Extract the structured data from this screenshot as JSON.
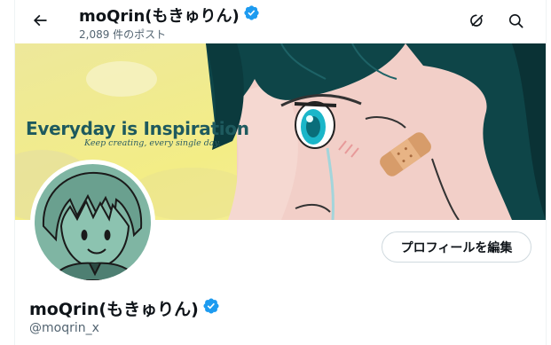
{
  "header": {
    "display_name": "moQrin(もきゅりん)",
    "post_count": "2,089 件のポスト"
  },
  "banner": {
    "headline": "Everyday is Inspiration",
    "tagline": "Keep creating, every single day."
  },
  "profile": {
    "display_name": "moQrin(もきゅりん)",
    "handle": "@moqrin_x",
    "edit_button_label": "プロフィールを編集"
  },
  "icons": {
    "back": "arrow-left-icon",
    "grok": "grok-icon",
    "search": "search-icon",
    "verified": "verified-badge-icon"
  },
  "colors": {
    "verified_blue": "#1d9bf0",
    "text_primary": "#0f1419",
    "text_secondary": "#536471",
    "border": "#cfd9de"
  }
}
